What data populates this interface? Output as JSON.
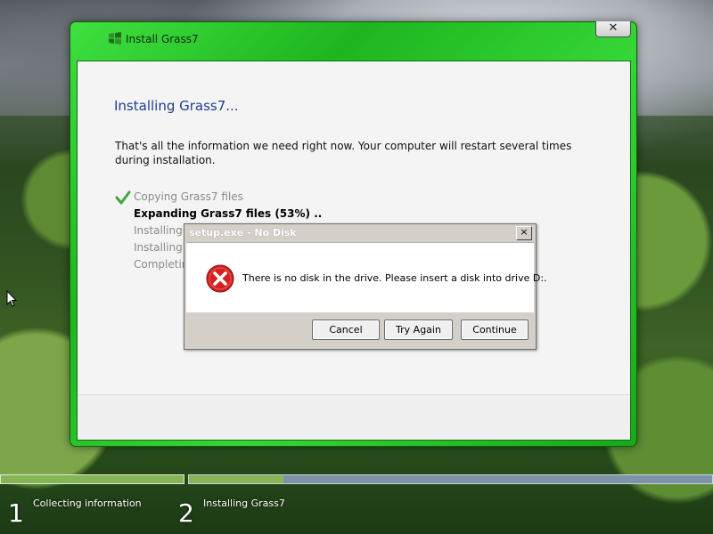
{
  "installer": {
    "title": "Install Grass7",
    "close_glyph": "✕",
    "heading": "Installing Grass7...",
    "intro": "That's all the information we need right now. Your computer will restart several times during installation.",
    "steps": [
      {
        "label": "Copying Grass7 files",
        "status": "done"
      },
      {
        "label": "Expanding Grass7 files (53%) ..",
        "status": "active"
      },
      {
        "label": "Installing features",
        "status": "pending"
      },
      {
        "label": "Installing updates",
        "status": "pending"
      },
      {
        "label": "Completing installation",
        "status": "pending"
      }
    ],
    "steps_visible": [
      "Copying Grass7 files",
      "Expanding Grass7 files (53%) ..",
      "Installing fe",
      "Installing u",
      "Completin"
    ]
  },
  "dialog": {
    "title": "setup.exe - No Disk",
    "close_glyph": "×",
    "message": "There is no disk in the drive. Please insert a disk into drive D:.",
    "icon": "error-icon",
    "buttons": {
      "cancel": "Cancel",
      "try_again": "Try Again",
      "continue": "Continue"
    }
  },
  "phases": [
    {
      "number": "1",
      "label": "Collecting information",
      "progress": 1.0
    },
    {
      "number": "2",
      "label": "Installing Grass7",
      "progress": 0.18
    }
  ],
  "colors": {
    "window_frame": "#1fb51f",
    "heading": "#1e3e8c",
    "progress_done": "#86b556",
    "progress_track": "#7e93a8",
    "error_red": "#d42020"
  }
}
